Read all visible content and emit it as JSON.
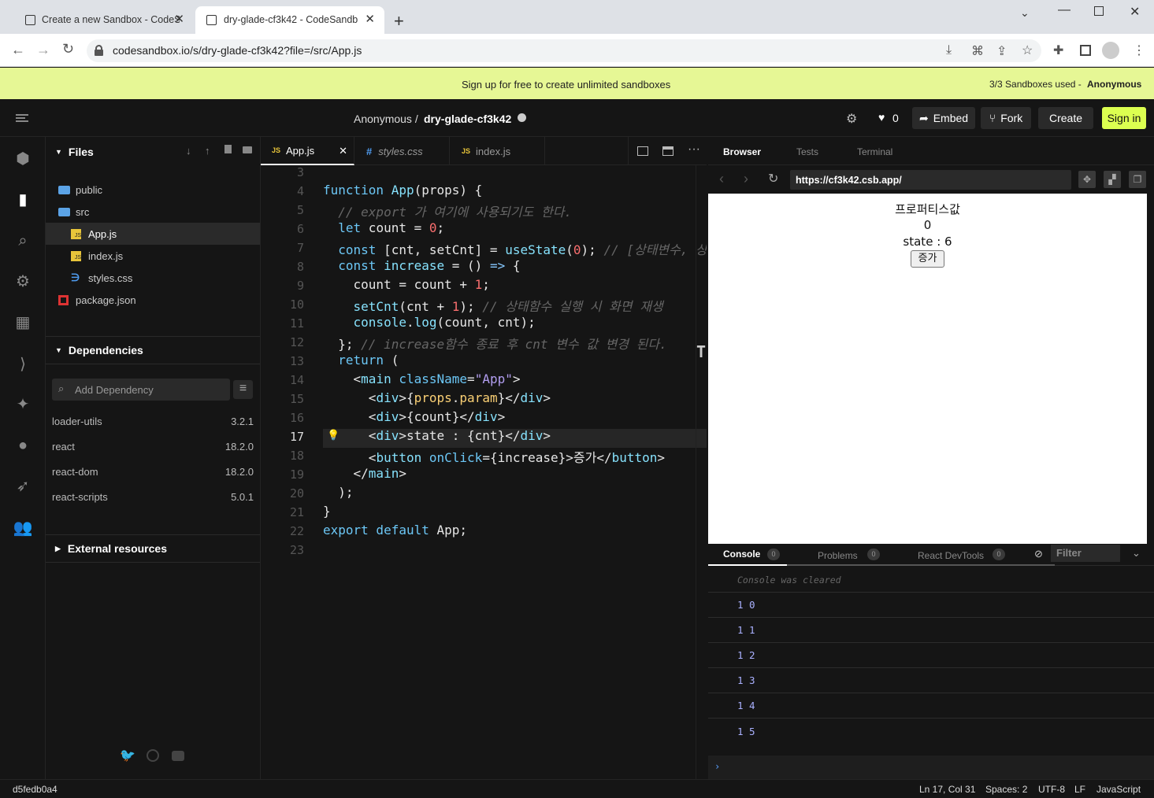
{
  "browser": {
    "tabs": [
      {
        "title": "Create a new Sandbox - CodeS"
      },
      {
        "title": "dry-glade-cf3k42 - CodeSandb"
      }
    ],
    "url": "codesandbox.io/s/dry-glade-cf3k42?file=/src/App.js"
  },
  "banner": {
    "text": "Sign up for free to create unlimited sandboxes",
    "usage": "3/3 Sandboxes used - ",
    "user": "Anonymous"
  },
  "header": {
    "owner": "Anonymous /",
    "sandbox": "dry-glade-cf3k42",
    "likes": "0",
    "embed": "Embed",
    "fork": "Fork",
    "create": "Create",
    "signin": "Sign in"
  },
  "files": {
    "title": "Files",
    "items": [
      "public",
      "src",
      "App.js",
      "index.js",
      "styles.css",
      "package.json"
    ]
  },
  "dependencies": {
    "title": "Dependencies",
    "placeholder": "Add Dependency",
    "items": [
      {
        "name": "loader-utils",
        "version": "3.2.1"
      },
      {
        "name": "react",
        "version": "18.2.0"
      },
      {
        "name": "react-dom",
        "version": "18.2.0"
      },
      {
        "name": "react-scripts",
        "version": "5.0.1"
      }
    ]
  },
  "external": {
    "title": "External resources"
  },
  "editor": {
    "tabs": [
      "App.js",
      "styles.css",
      "index.js"
    ],
    "line_numbers": [
      "3",
      "4",
      "5",
      "6",
      "7",
      "8",
      "9",
      "10",
      "11",
      "12",
      "13",
      "14",
      "15",
      "16",
      "17",
      "18",
      "19",
      "20",
      "21",
      "22",
      "23"
    ]
  },
  "preview": {
    "tabs": [
      "Browser",
      "Tests",
      "Terminal"
    ],
    "url": "https://cf3k42.csb.app/",
    "content": [
      "프로퍼티스값",
      "0",
      "state : 6"
    ],
    "button": "증가"
  },
  "console": {
    "tabs": [
      {
        "label": "Console",
        "count": "0"
      },
      {
        "label": "Problems",
        "count": "0"
      },
      {
        "label": "React DevTools",
        "count": "0"
      }
    ],
    "filter_placeholder": "Filter",
    "cleared": "Console was cleared",
    "rows": [
      "1 0",
      "1 1",
      "1 2",
      "1 3",
      "1 4",
      "1 5"
    ]
  },
  "status": {
    "hash": "d5fedb0a4",
    "position": "Ln 17, Col 31",
    "spaces": "Spaces: 2",
    "encoding": "UTF-8",
    "eol": "LF",
    "language": "JavaScript"
  }
}
